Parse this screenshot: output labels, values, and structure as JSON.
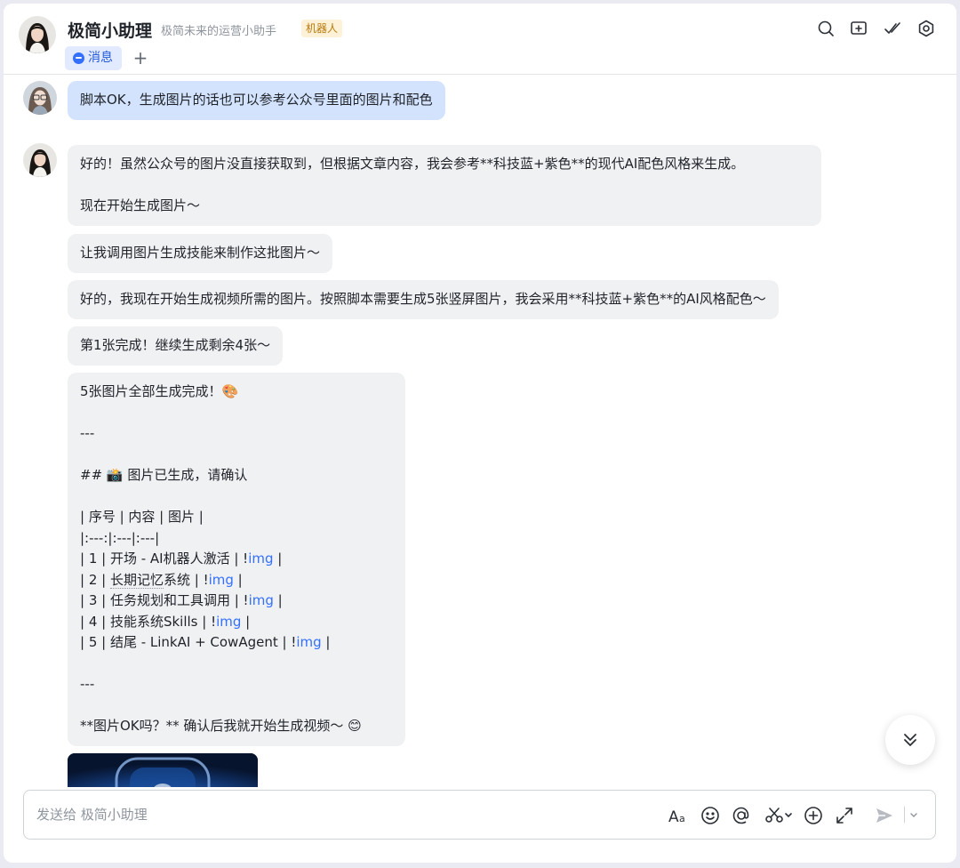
{
  "header": {
    "title": "极简小助理",
    "subtitle": "极简未来的运营小助手",
    "badge": "机器人",
    "tab_label": "消息",
    "add_tab": "+"
  },
  "messages": {
    "user_1": "脚本OK，生成图片的话也可以参考公众号里面的图片和配色",
    "bot_1": "好的！虽然公众号的图片没直接获取到，但根据文章内容，我会参考**科技蓝+紫色**的现代AI配色风格来生成。\n\n现在开始生成图片～",
    "bot_2": "让我调用图片生成技能来制作这批图片～",
    "bot_3": "好的，我现在开始生成视频所需的图片。按照脚本需要生成5张竖屏图片，我会采用**科技蓝+紫色**的AI风格配色～",
    "bot_4": "第1张完成！继续生成剩余4张～",
    "bot_5": {
      "line1": "5张图片全部生成完成！🎨",
      "sep": "---",
      "heading": "## 📸 图片已生成，请确认",
      "table_header": "| 序号 | 内容 | 图片 |",
      "table_align": "|:---:|:---|:---|",
      "rows": [
        {
          "pre": "| 1 | 开场 - AI机器人激活 | !",
          "link": "img",
          "post": " |"
        },
        {
          "pre_a": "| 2 | ",
          "dotted": "长期记忆",
          "pre_b": "系统 | !",
          "link": "img",
          "post": " |"
        },
        {
          "pre": "| 3 | 任务规划和工具调用 | !",
          "link": "img",
          "post": " |"
        },
        {
          "pre": "| 4 | 技能系统Skills | !",
          "link": "img",
          "post": " |"
        },
        {
          "pre": "| 5 | 结尾 - LinkAI + CowAgent | !",
          "link": "img",
          "post": " |"
        }
      ],
      "sep2": "---",
      "closing": "**图片OK吗？** 确认后我就开始生成视频～ 😊"
    }
  },
  "composer": {
    "placeholder": "发送给 极简小助理"
  },
  "icons": {
    "header": [
      "search-icon",
      "add-window-icon",
      "check-icon",
      "settings-icon"
    ],
    "composer": [
      "font-format-icon",
      "emoji-icon",
      "mention-icon",
      "scissors-icon",
      "plus-circle-icon",
      "expand-icon",
      "send-icon",
      "chevron-down-icon"
    ]
  },
  "colors": {
    "user_bubble": "#d3e3fd",
    "bot_bubble": "#f0f1f3",
    "link": "#3370ff",
    "badge_bg": "#fdf1d8",
    "badge_text": "#b77a0a"
  }
}
